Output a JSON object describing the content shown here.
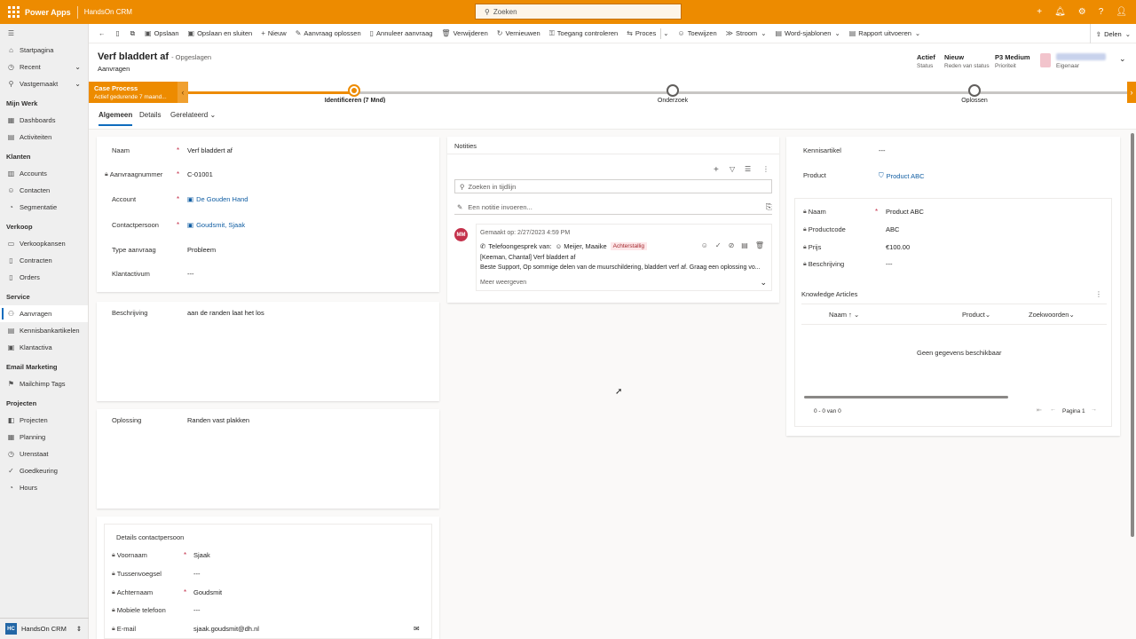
{
  "topbar": {
    "brand": "Power Apps",
    "app_name": "HandsOn CRM",
    "search_placeholder": "Zoeken",
    "icons": [
      "plus-icon",
      "bell-icon",
      "gear-icon",
      "help-icon",
      "user-icon"
    ]
  },
  "sidebar": {
    "top_items": [
      {
        "label": "Startpagina",
        "icon": "home-icon"
      },
      {
        "label": "Recent",
        "icon": "clock-icon",
        "chevron": true
      },
      {
        "label": "Vastgemaakt",
        "icon": "pin-icon",
        "chevron": true
      }
    ],
    "groups": [
      {
        "title": "Mijn Werk",
        "items": [
          {
            "label": "Dashboards"
          },
          {
            "label": "Activiteiten"
          }
        ]
      },
      {
        "title": "Klanten",
        "items": [
          {
            "label": "Accounts"
          },
          {
            "label": "Contacten"
          },
          {
            "label": "Segmentatie"
          }
        ]
      },
      {
        "title": "Verkoop",
        "items": [
          {
            "label": "Verkoopkansen"
          },
          {
            "label": "Contracten"
          },
          {
            "label": "Orders"
          }
        ]
      },
      {
        "title": "Service",
        "items": [
          {
            "label": "Aanvragen",
            "active": true
          },
          {
            "label": "Kennisbankartikelen"
          },
          {
            "label": "Klantactiva"
          }
        ]
      },
      {
        "title": "Email Marketing",
        "items": [
          {
            "label": "Mailchimp Tags"
          }
        ]
      },
      {
        "title": "Projecten",
        "items": [
          {
            "label": "Projecten"
          },
          {
            "label": "Planning"
          },
          {
            "label": "Urenstaat"
          },
          {
            "label": "Goedkeuring"
          },
          {
            "label": "Hours"
          }
        ]
      }
    ],
    "area_badge": "HC",
    "area_label": "HandsOn CRM"
  },
  "commands": [
    "Opslaan",
    "Opslaan en sluiten",
    "Nieuw",
    "Aanvraag oplossen",
    "Annuleer aanvraag",
    "Verwijderen",
    "Vernieuwen",
    "Toegang controleren",
    "Proces",
    "Toewijzen",
    "Stroom",
    "Word-sjablonen",
    "Rapport uitvoeren"
  ],
  "share_label": "Delen",
  "record": {
    "title": "Verf bladdert af",
    "saved": "- Opgeslagen",
    "entity": "Aanvragen",
    "header_fields": [
      {
        "value": "Actief",
        "label": "Status"
      },
      {
        "value": "Nieuw",
        "label": "Reden van status"
      },
      {
        "value": "P3 Medium",
        "label": "Prioriteit"
      }
    ],
    "owner_label": "Eigenaar"
  },
  "bpf": {
    "name": "Case Process",
    "sub": "Actief gedurende 7 maand...",
    "stages": [
      {
        "label": "Identificeren  (7 Mnd)",
        "active": true
      },
      {
        "label": "Onderzoek"
      },
      {
        "label": "Oplossen"
      }
    ]
  },
  "tabs": [
    "Algemeen",
    "Details",
    "Gerelateerd"
  ],
  "general": {
    "fields": [
      {
        "label": "Naam",
        "value": "Verf bladdert af",
        "required": true
      },
      {
        "label": "Aanvraagnummer",
        "value": "C-01001",
        "required": true,
        "locked": true
      },
      {
        "label": "Account",
        "value": "De Gouden Hand",
        "required": true,
        "link": true
      },
      {
        "label": "Contactpersoon",
        "value": "Goudsmit, Sjaak",
        "required": true,
        "link": true
      },
      {
        "label": "Type aanvraag",
        "value": "Probleem"
      },
      {
        "label": "Klantactivum",
        "value": "---"
      }
    ],
    "description": {
      "label": "Beschrijving",
      "value": "aan de randen laat het los"
    },
    "resolution": {
      "label": "Oplossing",
      "value": "Randen vast plakken"
    }
  },
  "contact_details": {
    "title": "Details contactpersoon",
    "fields": [
      {
        "label": "Voornaam",
        "value": "Sjaak",
        "required": true
      },
      {
        "label": "Tussenvoegsel",
        "value": "---"
      },
      {
        "label": "Achternaam",
        "value": "Goudsmit",
        "required": true
      },
      {
        "label": "Mobiele telefoon",
        "value": "---"
      },
      {
        "label": "E-mail",
        "value": "sjaak.goudsmit@dh.nl"
      }
    ]
  },
  "timeline": {
    "title": "Notities",
    "search_placeholder": "Zoeken in tijdlijn",
    "note_placeholder": "Een notitie invoeren...",
    "item": {
      "avatar": "MM",
      "created": "Gemaakt op: 2/27/2023 4:59 PM",
      "type": "Telefoongesprek van:",
      "from": "Meijer, Maaike",
      "badge": "Achterstallig",
      "line1": "[Keeman, Chantal] Verf bladdert af",
      "line2": "Beste Support, Op sommige delen van de muurschildering, bladdert verf af. Graag een oplossing vo...",
      "more": "Meer weergeven"
    }
  },
  "right": {
    "kennis": {
      "label": "Kennisartikel",
      "value": "---"
    },
    "product": {
      "label": "Product",
      "value": "Product ABC"
    },
    "product_fields": [
      {
        "label": "Naam",
        "value": "Product ABC",
        "required": true
      },
      {
        "label": "Productcode",
        "value": "ABC"
      },
      {
        "label": "Prijs",
        "value": "€100.00"
      },
      {
        "label": "Beschrijving",
        "value": "---"
      }
    ],
    "ka": {
      "title": "Knowledge Articles",
      "columns": [
        "Naam ↑",
        "Product",
        "Zoekwoorden"
      ],
      "empty": "Geen gegevens beschikbaar",
      "count": "0 - 0 van 0",
      "page": "Pagina 1"
    }
  }
}
